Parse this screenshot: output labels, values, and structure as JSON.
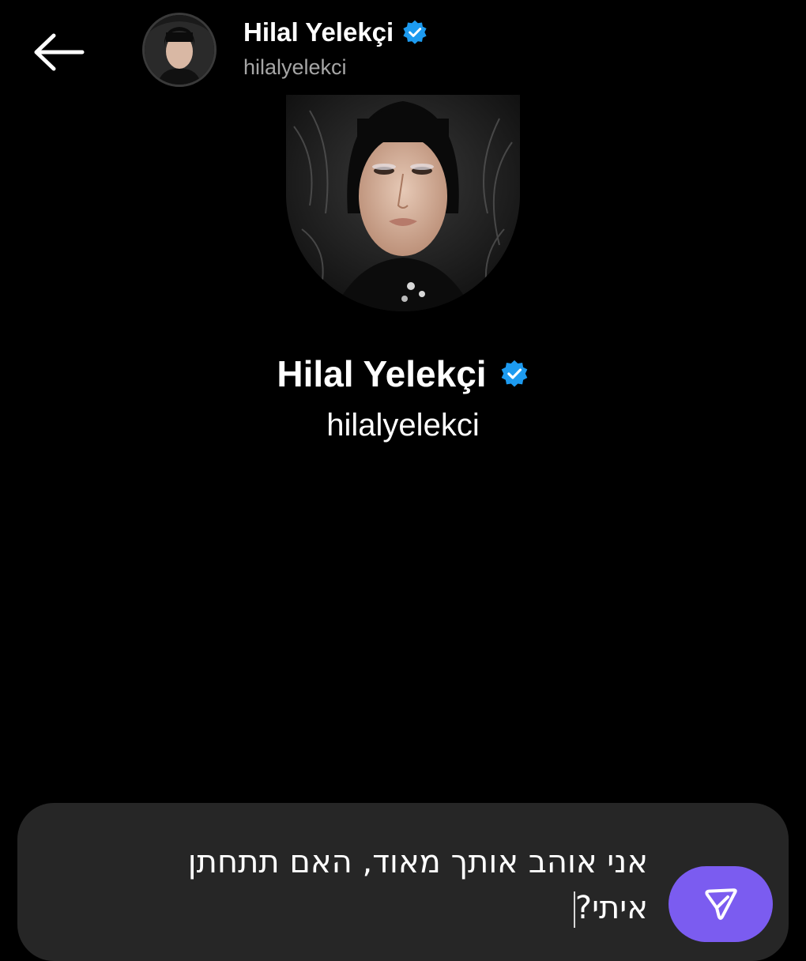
{
  "header": {
    "name": "Hilal Yelekçi",
    "handle": "hilalyelekci"
  },
  "profile": {
    "name": "Hilal Yelekçi",
    "handle": "hilalyelekci"
  },
  "composer": {
    "message_line1": "אני אוהב אותך מאוד, האם תתחתן",
    "message_line2": "איתי?"
  },
  "icons": {
    "back": "arrow-left-icon",
    "verified": "verified-badge-icon",
    "send": "send-icon"
  },
  "colors": {
    "background": "#000000",
    "verified": "#1d9bf0",
    "send_button": "#7b5cf0",
    "composer": "#262626",
    "handle_muted": "#a6a6a6"
  }
}
